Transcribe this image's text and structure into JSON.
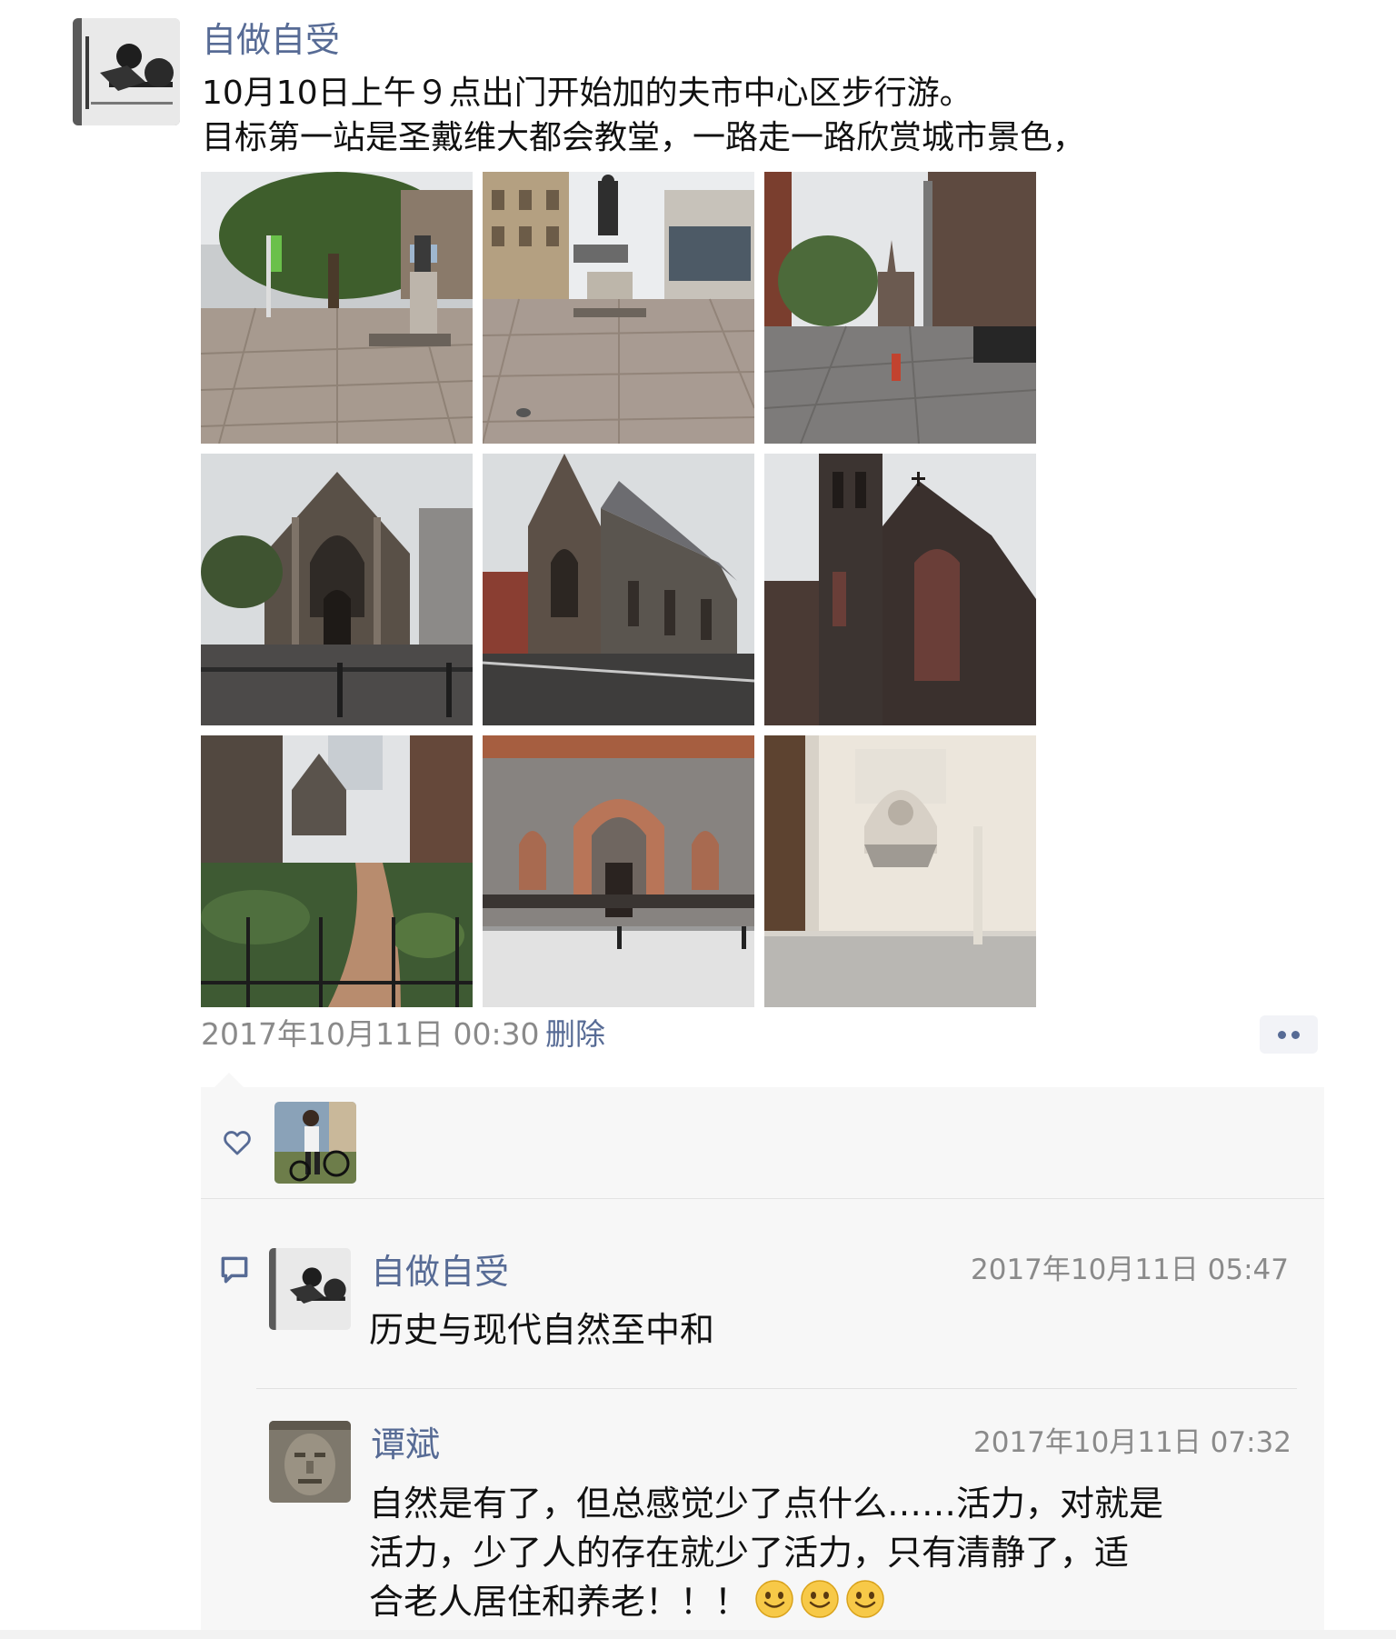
{
  "post": {
    "author": "自做自受",
    "text_lines": [
      "10月10日上午９点出门开始加的夫市中心区步行游。",
      "目标第一站是圣戴维大都会教堂，一路走一路欣赏城市景色，"
    ],
    "timestamp": "2017年10月11日 00:30",
    "delete_label": "删除",
    "photos": [
      {
        "icon": "photo-plaza-statue"
      },
      {
        "icon": "photo-statue-street"
      },
      {
        "icon": "photo-street-church"
      },
      {
        "icon": "photo-church-front"
      },
      {
        "icon": "photo-church-side"
      },
      {
        "icon": "photo-church-tower"
      },
      {
        "icon": "photo-garden-path"
      },
      {
        "icon": "photo-church-entrance"
      },
      {
        "icon": "photo-holy-water-font"
      }
    ]
  },
  "likes": {
    "icon": "heart-outline-icon"
  },
  "comments": [
    {
      "author": "自做自受",
      "time": "2017年10月11日 05:47",
      "text_lines": [
        "历史与现代自然至中和"
      ]
    },
    {
      "author": "谭斌",
      "time": "2017年10月11日 07:32",
      "text_lines": [
        "自然是有了，但总感觉少了点什么……活力，对就是",
        "活力，少了人的存在就少了活力，只有清静了，适",
        "合老人居住和养老！！！"
      ],
      "emojis": [
        "smile-emoji",
        "smile-emoji",
        "smile-emoji"
      ]
    }
  ],
  "colors": {
    "link": "#576b95",
    "meta": "#8a8a8a",
    "panel": "#f7f7f7"
  }
}
